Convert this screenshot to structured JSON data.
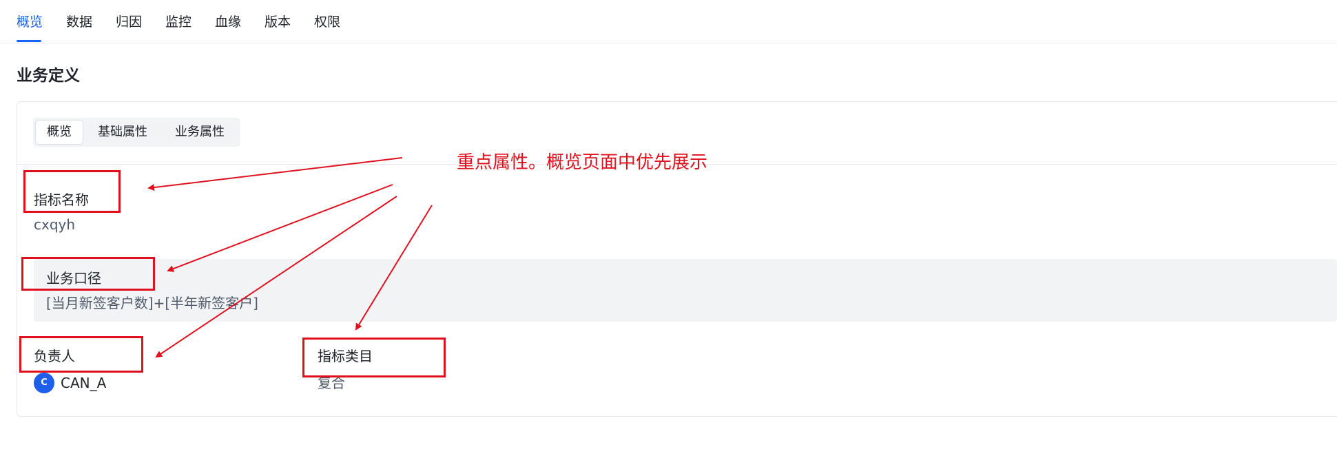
{
  "tabs": [
    "概览",
    "数据",
    "归因",
    "监控",
    "血缘",
    "版本",
    "权限"
  ],
  "active_tab": "概览",
  "section_title": "业务定义",
  "segmented": [
    "概览",
    "基础属性",
    "业务属性"
  ],
  "fields": {
    "metric_name": {
      "label": "指标名称",
      "value": "cxqyh"
    },
    "business_caliber": {
      "label": "业务口径",
      "value": "[当月新签客户数]+[半年新签客户]"
    },
    "owner": {
      "label": "负责人",
      "value": "CAN_A",
      "avatar_letter": "C"
    },
    "metric_category": {
      "label": "指标类目",
      "value": "复合"
    }
  },
  "annotation": {
    "text": "重点属性。概览页面中优先展示",
    "color": "#e0101e"
  },
  "colors": {
    "accent": "#1664ff",
    "avatar": "#1e5eeb"
  }
}
